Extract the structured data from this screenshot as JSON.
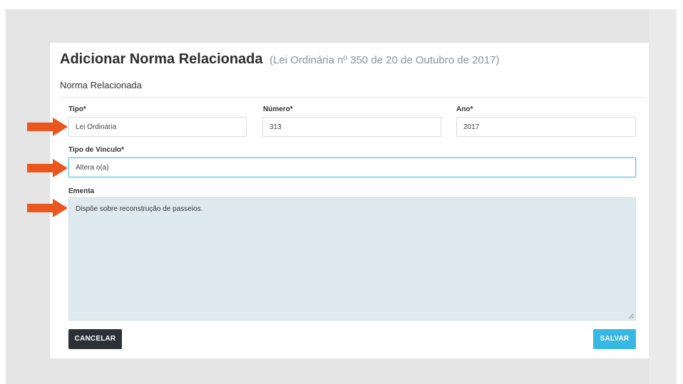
{
  "dialog": {
    "title": "Adicionar Norma Relacionada",
    "subtitle": "(Lei Ordinária nº 350 de 20 de Outubro de 2017)",
    "section_title": "Norma Relacionada"
  },
  "form": {
    "tipo": {
      "label": "Tipo*",
      "value": "Lei Ordinária"
    },
    "numero": {
      "label": "Número*",
      "value": "313"
    },
    "ano": {
      "label": "Ano*",
      "value": "2017"
    },
    "tipo_vinculo": {
      "label": "Tipo de Vinculo*",
      "value": "Altera o(a)"
    },
    "ementa": {
      "label": "Ementa",
      "value": "Dispõe sobre reconstrução de passeios."
    }
  },
  "buttons": {
    "cancel": "CANCELAR",
    "save": "SALVAR"
  },
  "colors": {
    "arrow": "#e9561e",
    "save": "#36b7e4",
    "cancel": "#2c3138",
    "focus_border": "#4cc3dc",
    "textarea_bg": "#dfeaef"
  },
  "annotations": {
    "arrow_count": 3,
    "arrow_icon": "arrow-right-icon"
  }
}
